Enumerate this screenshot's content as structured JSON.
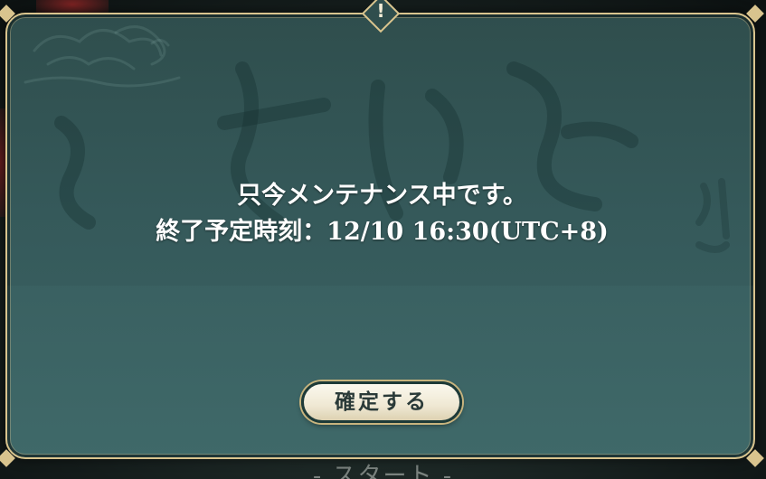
{
  "dialog": {
    "alert_mark": "!",
    "message_line1": "只今メンテナンス中です。",
    "message_line2": "終了予定時刻：12/10 16:30(UTC+8)",
    "confirm_label": "確定する"
  },
  "background": {
    "start_caption": "- スタート -"
  },
  "colors": {
    "frame_gold": "#d9c48e",
    "panel_teal": "#35595a",
    "text_white": "#ffffff",
    "button_cream": "#f4efdf"
  }
}
